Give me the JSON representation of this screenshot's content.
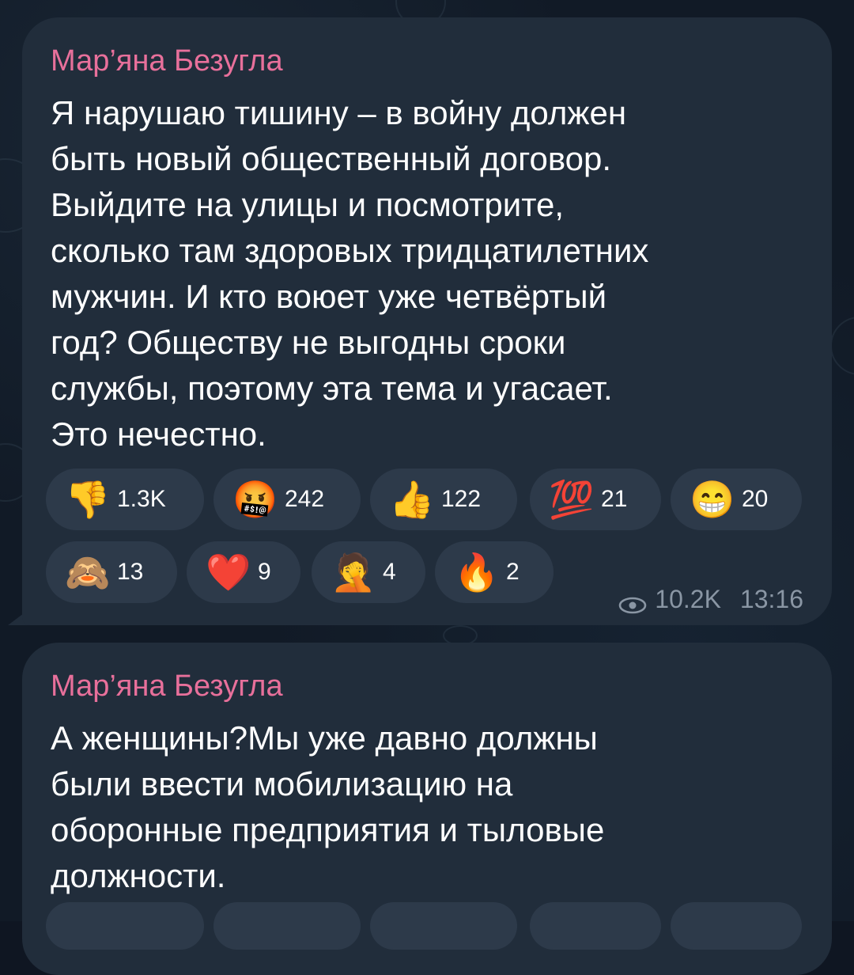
{
  "messages": [
    {
      "author": "Мар’яна Безугла",
      "text": [
        "Я нарушаю тишину – в войну должен",
        "быть новый общественный договор.",
        "Выйдите на улицы и посмотрите,",
        "сколько там здоровых тридцатилетних",
        "мужчин. И кто воюет уже четвёртый",
        "год? Обществу не выгодны сроки",
        "службы, поэтому эта тема и угасает.",
        "Это нечестно."
      ],
      "reactions": [
        {
          "icon": "thumbs-down",
          "emoji": "👎",
          "count": "1.3K"
        },
        {
          "icon": "cursing-face",
          "emoji": "🤬",
          "count": "242"
        },
        {
          "icon": "thumbs-up",
          "emoji": "👍",
          "count": "122"
        },
        {
          "icon": "hundred-points",
          "emoji": "💯",
          "count": "21"
        },
        {
          "icon": "grinning-face",
          "emoji": "😁",
          "count": "20"
        },
        {
          "icon": "see-no-evil-monkey",
          "emoji": "🙈",
          "count": "13"
        },
        {
          "icon": "red-heart",
          "emoji": "❤️",
          "count": "9"
        },
        {
          "icon": "facepalm",
          "emoji": "🤦",
          "count": "4"
        },
        {
          "icon": "fire",
          "emoji": "🔥",
          "count": "2"
        }
      ],
      "views": "10.2K",
      "time": "13:16"
    },
    {
      "author": "Мар’яна Безугла",
      "text": [
        "А женщины?Мы уже давно должны",
        "были ввести мобилизацию на",
        "оборонные предприятия и тыловые",
        "должности."
      ]
    }
  ],
  "colors": {
    "background": "#111a26",
    "bubble": "#212d3b",
    "chip": "#2d3a4a",
    "author": "#e8709b",
    "meta": "#8a96a4"
  }
}
